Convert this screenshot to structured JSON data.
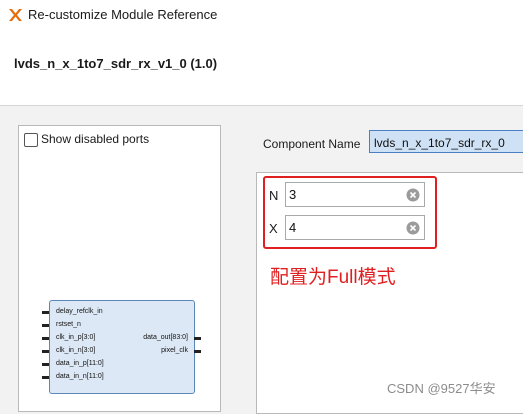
{
  "window": {
    "title": "Re-customize Module Reference"
  },
  "header": {
    "module_title": "lvds_n_x_1to7_sdr_rx_v1_0 (1.0)"
  },
  "left_panel": {
    "show_disabled_ports_label": "Show disabled ports",
    "show_disabled_ports_checked": false,
    "symbol": {
      "inputs": [
        "delay_refclk_in",
        "rstset_n",
        "clk_in_p[3:0]",
        "clk_in_n[3:0]",
        "data_in_p[11:0]",
        "data_in_n[11:0]"
      ],
      "outputs": [
        "data_out[83:0]",
        "pixel_clk"
      ]
    }
  },
  "component": {
    "label": "Component Name",
    "value": "lvds_n_x_1to7_sdr_rx_0"
  },
  "params": [
    {
      "label": "N",
      "value": "3"
    },
    {
      "label": "X",
      "value": "4"
    }
  ],
  "annotation": "配置为Full模式",
  "watermark": "CSDN @9527华安",
  "colors": {
    "accent_red": "#e02020",
    "symbol_fill": "#dce8f5",
    "selection_blue": "#cfe1f5"
  },
  "icons": {
    "app": "module-app-icon",
    "clear": "clear-circle-x-icon"
  }
}
